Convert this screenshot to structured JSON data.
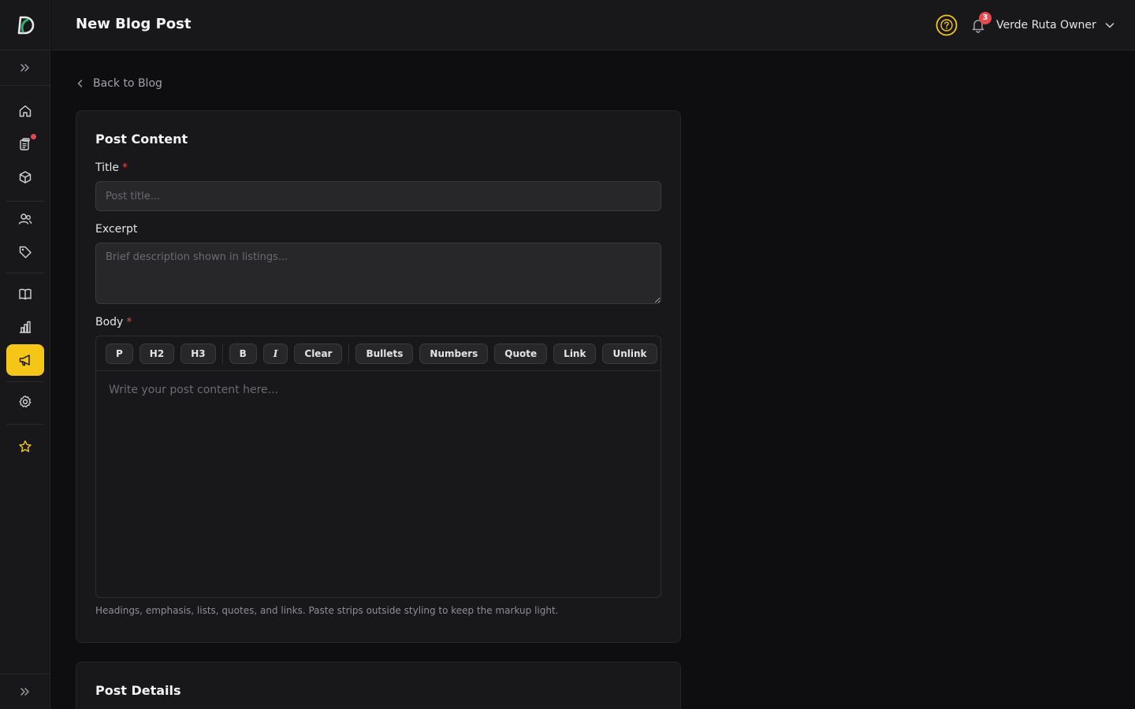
{
  "header": {
    "title": "New Blog Post",
    "user_name": "Verde Ruta Owner",
    "notification_count": "3"
  },
  "sidebar": {
    "logo_icon": "d-logo-icon",
    "items": [
      {
        "icon": "home-icon",
        "active": false
      },
      {
        "icon": "clipboard-icon",
        "active": false,
        "has_dot": true
      },
      {
        "icon": "box-icon",
        "active": false
      },
      {
        "icon": "users-icon",
        "active": false
      },
      {
        "icon": "tag-icon",
        "active": false
      },
      {
        "icon": "book-icon",
        "active": false
      },
      {
        "icon": "bar-chart-icon",
        "active": false
      },
      {
        "icon": "megaphone-icon",
        "active": true
      },
      {
        "icon": "gear-icon",
        "active": false
      },
      {
        "icon": "star-icon",
        "active": false
      }
    ]
  },
  "back_link": {
    "label": "Back to Blog"
  },
  "post_content": {
    "title": "Post Content",
    "title_label": "Title",
    "title_placeholder": "Post title...",
    "excerpt_label": "Excerpt",
    "excerpt_placeholder": "Brief description shown in listings...",
    "body_label": "Body",
    "required_mark": "*",
    "toolbar": {
      "p": "P",
      "h2": "H2",
      "h3": "H3",
      "bold": "B",
      "italic": "I",
      "clear": "Clear",
      "bullets": "Bullets",
      "numbers": "Numbers",
      "quote": "Quote",
      "link": "Link",
      "unlink": "Unlink"
    },
    "body_placeholder": "Write your post content here...",
    "hint": "Headings, emphasis, lists, quotes, and links. Paste strips outside styling to keep the markup light."
  },
  "post_details": {
    "title": "Post Details"
  },
  "colors": {
    "accent": "#f5c518",
    "danger": "#e5484d",
    "background": "#0e0e10",
    "surface": "#18181b"
  }
}
